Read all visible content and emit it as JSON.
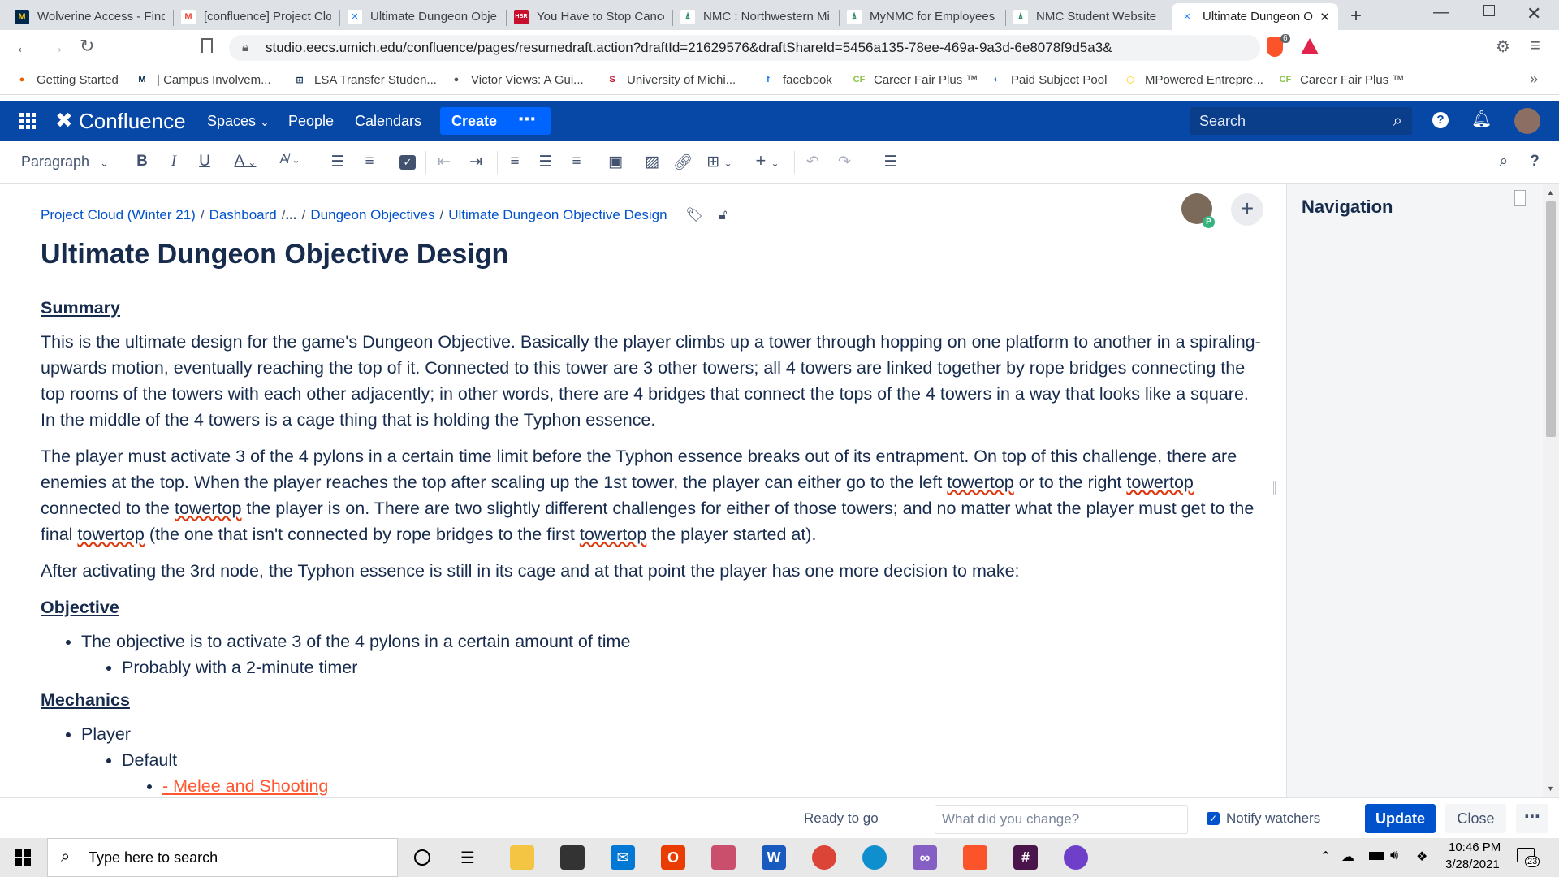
{
  "browser": {
    "tabs": [
      {
        "title": "Wolverine Access - Find",
        "icon": "M",
        "color": "#ffcb05",
        "bg": "#00274c"
      },
      {
        "title": "[confluence] Project Clo",
        "icon": "M",
        "color": "#ea4335",
        "bg": "#ffffff"
      },
      {
        "title": "Ultimate Dungeon Obje",
        "icon": "✕",
        "color": "#2684ff",
        "bg": "#ffffff"
      },
      {
        "title": "You Have to Stop Cance",
        "icon": "HBR",
        "color": "#ffffff",
        "bg": "#c8102e"
      },
      {
        "title": "NMC : Northwestern Mi",
        "icon": "⍋",
        "color": "#1b7f5b",
        "bg": "#ffffff"
      },
      {
        "title": "MyNMC for Employees",
        "icon": "⍋",
        "color": "#1b7f5b",
        "bg": "#ffffff"
      },
      {
        "title": "NMC Student Website",
        "icon": "⍋",
        "color": "#1b7f5b",
        "bg": "#ffffff"
      },
      {
        "title": "Ultimate Dungeon O",
        "icon": "✕",
        "color": "#2684ff",
        "bg": "#ffffff"
      }
    ],
    "url": "studio.eecs.umich.edu/confluence/pages/resumedraft.action?draftId=21629576&draftShareId=5456a135-78ee-469a-9a3d-6e8078f9d5a3&",
    "shield_count": "6",
    "bookmarks": [
      {
        "label": "Getting Started",
        "icon": "●",
        "color": "#e66000"
      },
      {
        "label": "| Campus Involvem...",
        "icon": "M",
        "color": "#00274c"
      },
      {
        "label": "LSA Transfer Studen...",
        "icon": "⊞",
        "color": "#00274c"
      },
      {
        "label": "Victor Views: A Gui...",
        "icon": "●",
        "color": "#555555"
      },
      {
        "label": "University of Michi...",
        "icon": "S",
        "color": "#c8102e"
      },
      {
        "label": "facebook",
        "icon": "f",
        "color": "#1877f2"
      },
      {
        "label": "Career Fair Plus ™",
        "icon": "CF",
        "color": "#8bc34a"
      },
      {
        "label": "Paid Subject Pool",
        "icon": "◐",
        "color": "#2a6ebb"
      },
      {
        "label": "MPowered Entrepre...",
        "icon": "⬡",
        "color": "#ffcb05"
      },
      {
        "label": "Career Fair Plus ™",
        "icon": "CF",
        "color": "#8bc34a"
      }
    ]
  },
  "confluence": {
    "brand": "Confluence",
    "nav": {
      "spaces": "Spaces",
      "people": "People",
      "calendars": "Calendars",
      "create": "Create",
      "search_placeholder": "Search"
    },
    "toolbar": {
      "paragraph": "Paragraph"
    },
    "breadcrumb": {
      "items": [
        "Project Cloud (Winter 21)",
        "Dashboard",
        "Dungeon Objectives",
        "Ultimate Dungeon Objective Design"
      ],
      "ellipsis": "..."
    },
    "avatar_badge": "P",
    "title": "Ultimate Dungeon Objective Design",
    "sections": {
      "summary_heading": "Summary",
      "summary_p1": "This is the ultimate design for the game's Dungeon Objective. Basically the player climbs up a tower through hopping on one platform to another in a spiraling-upwards motion, eventually reaching the top of it. Connected to this tower are 3 other towers; all 4 towers are linked together by rope bridges connecting the top rooms of the towers with each other adjacently; in other words, there are 4 bridges that connect the tops of the 4 towers in a way that looks like a square. In the middle of the 4 towers is a cage thing that is holding the Typhon essence.",
      "summary_p2": {
        "a": "The player must activate 3 of the 4 pylons in a certain time limit before the Typhon essence breaks out of its entrapment. On top of this challenge, there are enemies at the top. When the player reaches the top after scaling up the 1st tower, the player can either go to the left ",
        "w1": "towertop",
        "b": " or to the right ",
        "w2": "towertop",
        "c": " connected to the ",
        "w3": "towertop",
        "d": " the player is on. There are two slightly different challenges for either of those towers; and no matter what the player must get to the final ",
        "w4": "towertop",
        "e": " (the one that isn't connected by rope bridges to the first ",
        "w5": "towertop",
        "f": " the player started at)."
      },
      "summary_p3": "After activating the 3rd node, the Typhon essence is still in its cage and at that point the player has one more decision to make:",
      "objective_heading": "Objective",
      "objective_item": "The objective is to activate 3 of the 4 pylons in a certain amount of time",
      "objective_sub": "Probably with a 2-minute timer",
      "mechanics_heading": "Mechanics",
      "mech_player": "Player",
      "mech_default": "Default",
      "mech_melee": "- Melee and Shooting"
    },
    "navigation_title": "Navigation",
    "footer": {
      "status": "Ready to go",
      "change_placeholder": "What did you change?",
      "notify": "Notify watchers",
      "update": "Update",
      "close": "Close"
    }
  },
  "taskbar": {
    "search_placeholder": "Type here to search",
    "time": "10:46 PM",
    "date": "3/28/2021",
    "notification_count": "23"
  }
}
